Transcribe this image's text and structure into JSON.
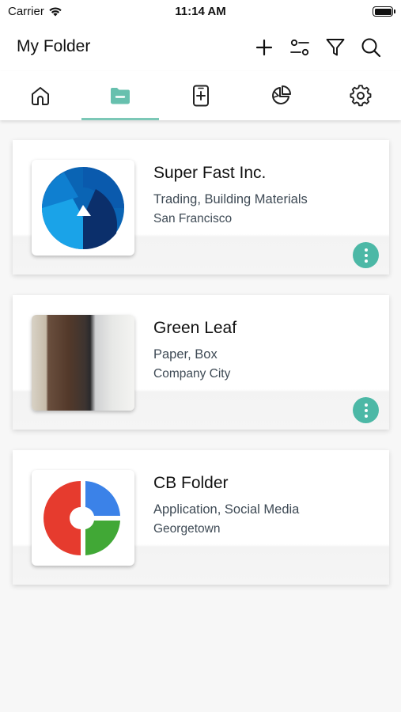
{
  "status_bar": {
    "carrier": "Carrier",
    "time": "11:14 AM"
  },
  "header": {
    "title": "My Folder",
    "actions": [
      "plus-icon",
      "sliders-icon",
      "filter-icon",
      "search-icon"
    ]
  },
  "tabs": [
    {
      "icon": "home-icon",
      "active": false
    },
    {
      "icon": "folder-icon",
      "active": true
    },
    {
      "icon": "add-document-icon",
      "active": false
    },
    {
      "icon": "pie-chart-icon",
      "active": false
    },
    {
      "icon": "gear-icon",
      "active": false
    }
  ],
  "colors": {
    "accent": "#4cb8a6",
    "tab_indicator": "#7cc8b7"
  },
  "companies": [
    {
      "name": "Super Fast Inc.",
      "categories": "Trading, Building Materials",
      "city": "San Francisco",
      "logo": "blue-swirl-logo",
      "has_menu": true
    },
    {
      "name": "Green Leaf",
      "categories": "Paper, Box",
      "city": "Company City",
      "logo": "building-photo",
      "has_menu": true
    },
    {
      "name": "CB Folder",
      "categories": "Application, Social Media",
      "city": "Georgetown",
      "logo": "quadrant-logo",
      "has_menu": false
    }
  ]
}
